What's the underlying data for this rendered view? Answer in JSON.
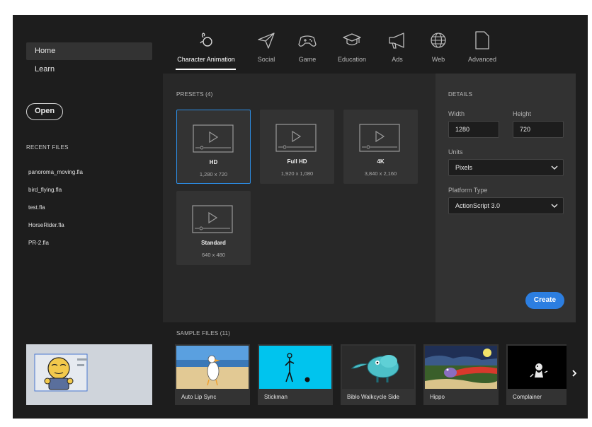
{
  "sidebar": {
    "nav": [
      {
        "label": "Home"
      },
      {
        "label": "Learn"
      }
    ],
    "open_label": "Open",
    "recent_title": "RECENT FILES",
    "recent_files": [
      "panoroma_moving.fla",
      "bird_flying.fla",
      "test.fla",
      "HorseRider.fla",
      "PR-2.fla"
    ]
  },
  "tabs": [
    {
      "label": "Character Animation",
      "icon": "character-animation-icon"
    },
    {
      "label": "Social",
      "icon": "paper-plane-icon"
    },
    {
      "label": "Game",
      "icon": "gamepad-icon"
    },
    {
      "label": "Education",
      "icon": "graduation-cap-icon"
    },
    {
      "label": "Ads",
      "icon": "megaphone-icon"
    },
    {
      "label": "Web",
      "icon": "globe-icon"
    },
    {
      "label": "Advanced",
      "icon": "document-icon"
    }
  ],
  "presets": {
    "title": "PRESETS (4)",
    "items": [
      {
        "name": "HD",
        "resolution": "1,280 x 720"
      },
      {
        "name": "Full HD",
        "resolution": "1,920 x 1,080"
      },
      {
        "name": "4K",
        "resolution": "3,840 x 2,160"
      },
      {
        "name": "Standard",
        "resolution": "640 x 480"
      }
    ]
  },
  "details": {
    "title": "DETAILS",
    "width_label": "Width",
    "width_value": "1280",
    "height_label": "Height",
    "height_value": "720",
    "units_label": "Units",
    "units_value": "Pixels",
    "platform_label": "Platform Type",
    "platform_value": "ActionScript 3.0",
    "create_label": "Create"
  },
  "samples": {
    "title": "SAMPLE FILES (11)",
    "items": [
      {
        "name": "Auto Lip Sync"
      },
      {
        "name": "Stickman"
      },
      {
        "name": "Biblo Walkcycle Side"
      },
      {
        "name": "Hippo"
      },
      {
        "name": "Complainer"
      }
    ]
  },
  "colors": {
    "accent": "#2c8ee6",
    "create_button": "#2c7ee0",
    "background": "#1d1d1d",
    "panel": "#282828",
    "details_panel": "#323232"
  }
}
